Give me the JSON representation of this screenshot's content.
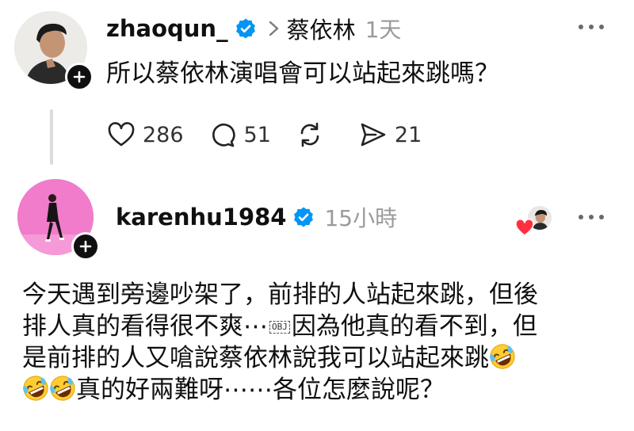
{
  "posts": [
    {
      "username": "zhaoqun_",
      "topic": "蔡依林",
      "time": "1天",
      "text": "所以蔡依林演唱會可以站起來跳嗎？",
      "likes": "286",
      "comments": "51",
      "shares": "21"
    },
    {
      "username": "karenhu1984",
      "time": "15小時",
      "text_lines": [
        "今天遇到旁邊吵架了，前排的人站起來跳，但後",
        "排人真的看得很不爽⋯",
        "因為他真的看不到，但",
        "是前排的人又嗆說蔡依林說我可以站起來跳",
        "真的好兩難呀⋯⋯各位怎麼說呢？"
      ],
      "obj_label": "OBJ"
    }
  ],
  "icons": {
    "verified": "verified-badge-icon",
    "chevron": "chevron-right-icon",
    "like": "heart-icon",
    "comment": "comment-bubble-icon",
    "repost": "repost-icon",
    "share": "send-icon",
    "follow": "plus-icon",
    "emoji": "rolling-on-floor-laughing-emoji"
  },
  "colors": {
    "verified_blue": "#0095f6",
    "muted_text": "#9a9a9a",
    "heart_red": "#ff3040",
    "avatar2_bg": "#f07ccb"
  }
}
